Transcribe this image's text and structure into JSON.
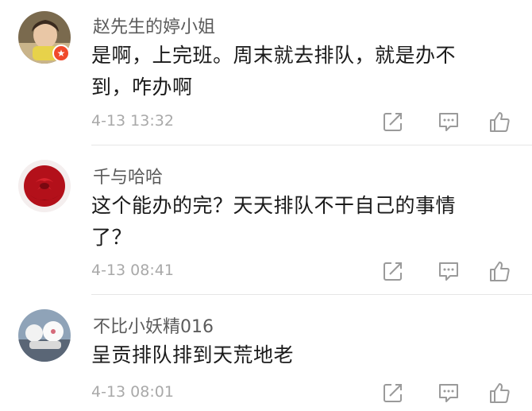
{
  "comments": [
    {
      "username": "赵先生的婷小姐",
      "content_line1": "是啊，上完班。周末就去排队，就是办不",
      "content_line2": "到，咋办啊",
      "timestamp": "4-13 13:32",
      "avatar_icon": "child-photo-avatar",
      "badge_icon": "star-badge-icon",
      "badge_color": "#f04a2b"
    },
    {
      "username": "千与哈哈",
      "content_line1": "这个能办的完？天天排队不干自己的事情",
      "content_line2": "了？",
      "timestamp": "4-13 08:41",
      "avatar_icon": "red-rose-avatar"
    },
    {
      "username": "不比小妖精016",
      "content_line1": "呈贡排队排到天荒地老",
      "timestamp": "4-13 08:01",
      "avatar_icon": "white-toy-avatar"
    }
  ],
  "actions": {
    "forward_icon": "forward-edit-icon",
    "reply_icon": "comment-bubble-icon",
    "like_icon": "thumbs-up-icon",
    "icon_color": "#9a9a9a"
  }
}
